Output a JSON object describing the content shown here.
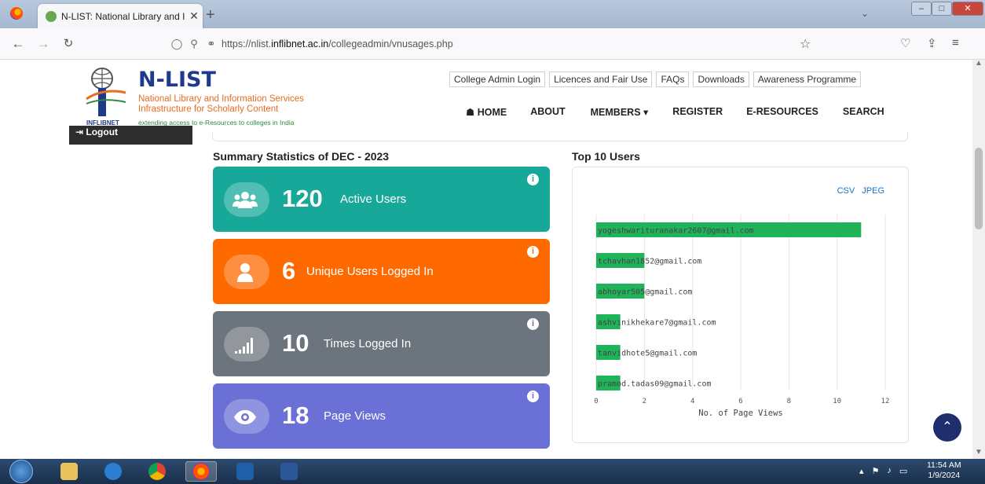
{
  "browser": {
    "tab_title": "N-LIST: National Library and Inf",
    "tab_close": "✕",
    "new_tab": "+",
    "url_prefix": "https://nlist.",
    "url_host": "inflibnet.ac.in",
    "url_path": "/collegeadmin/vnusages.php"
  },
  "logo": {
    "brand": "N-LIST",
    "line1": "National Library and Information Services",
    "line2": "Infrastructure for Scholarly Content",
    "line3": "extending access to e-Resources to colleges in India",
    "org": "INFLIBNET"
  },
  "top_links": [
    "College Admin Login",
    "Licences and Fair Use",
    "FAQs",
    "Downloads",
    "Awareness Programme"
  ],
  "main_nav": {
    "home": "HOME",
    "about": "ABOUT",
    "members": "MEMBERS",
    "register": "REGISTER",
    "eresources": "E-RESOURCES",
    "search": "SEARCH"
  },
  "sidebar": {
    "logout": "Logout"
  },
  "summary": {
    "title": "Summary Statistics of DEC - 2023",
    "cards": [
      {
        "value": "120",
        "label": "Active Users",
        "color": "#17a89a",
        "icon": "users-icon"
      },
      {
        "value": "6",
        "label": "Unique Users Logged In",
        "color": "#ff6a00",
        "icon": "user-icon"
      },
      {
        "value": "10",
        "label": "Times Logged In",
        "color": "#6c757d",
        "icon": "signal-icon"
      },
      {
        "value": "18",
        "label": "Page Views",
        "color": "#6a70d6",
        "icon": "eye-icon"
      }
    ]
  },
  "top_users": {
    "title": "Top 10 Users",
    "export_csv": "CSV",
    "export_jpeg": "JPEG"
  },
  "chart_data": {
    "type": "bar",
    "orientation": "horizontal",
    "categories": [
      "yogeshwarituranakar2607@gmail.com",
      "tchavhan1852@gmail.com",
      "abhoyar505@gmail.com",
      "ashvinikhekare7@gmail.com",
      "tanvidhote5@gmail.com",
      "pramod.tadas09@gmail.com"
    ],
    "values": [
      11,
      2,
      2,
      1,
      1,
      1
    ],
    "xlabel": "No. of Page Views",
    "xlim": [
      0,
      12
    ],
    "xticks": [
      0,
      2,
      4,
      6,
      8,
      10,
      12
    ],
    "bar_color": "#1fb35a",
    "grid": true
  },
  "taskbar": {
    "time": "11:54 AM",
    "date": "1/9/2024"
  }
}
